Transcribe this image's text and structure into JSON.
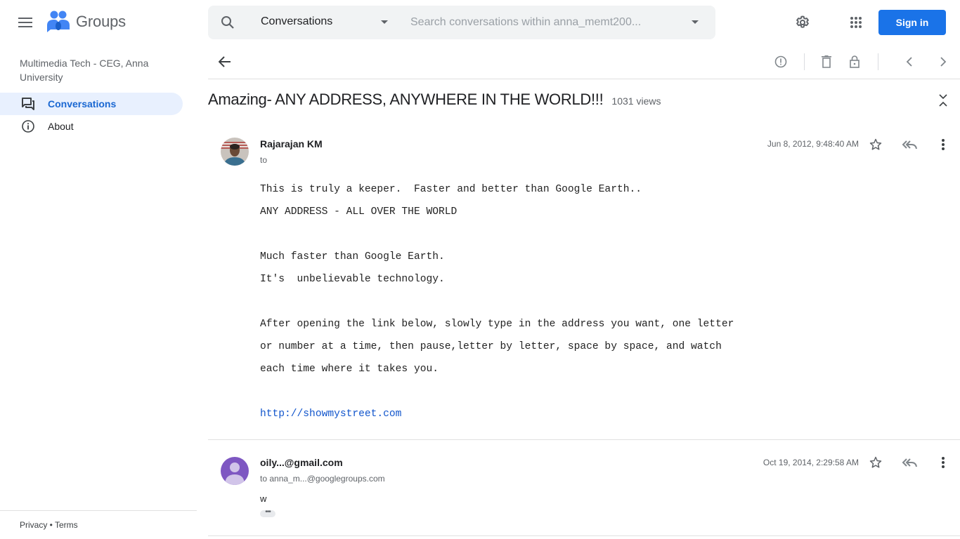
{
  "header": {
    "app_name": "Groups",
    "search_scope": "Conversations",
    "search_placeholder": "Search conversations within anna_memt200...",
    "sign_in_label": "Sign in",
    "brand_color": "#1a73e8"
  },
  "sidebar": {
    "group_name": "Multimedia Tech - CEG, Anna University",
    "items": [
      {
        "label": "Conversations",
        "icon": "forum-icon",
        "active": true
      },
      {
        "label": "About",
        "icon": "info-icon",
        "active": false
      }
    ],
    "footer": {
      "privacy": "Privacy",
      "separator": " • ",
      "terms": "Terms"
    }
  },
  "toolbar": {
    "back": "arrow-back-icon",
    "actions": [
      "report-icon",
      "delete-icon",
      "lock-icon",
      "chevron-left-icon",
      "chevron-right-icon"
    ]
  },
  "thread": {
    "title": "Amazing- ANY ADDRESS, ANYWHERE IN THE WORLD!!!",
    "views": "1031 views",
    "messages": [
      {
        "sender": "Rajarajan KM",
        "recipient": "to",
        "date": "Jun 8, 2012, 9:48:40 AM",
        "body_lines": [
          "This is truly a keeper.  Faster and better than Google Earth..",
          "ANY ADDRESS - ALL OVER THE WORLD",
          "",
          "Much faster than Google Earth.",
          "It's  unbelievable technology.",
          "",
          "After opening the link below, slowly type in the address you want, one letter",
          "or number at a time, then pause,letter by letter, space by space, and watch",
          "each time where it takes you.",
          ""
        ],
        "link": "http://showmystreet.com"
      },
      {
        "sender": "oily...@gmail.com",
        "recipient": "to anna_m...@googlegroups.com",
        "date": "Oct 19, 2014, 2:29:58 AM",
        "body": "w",
        "show_trimmed": "•••",
        "avatar_color": "#7e57c2"
      }
    ]
  }
}
